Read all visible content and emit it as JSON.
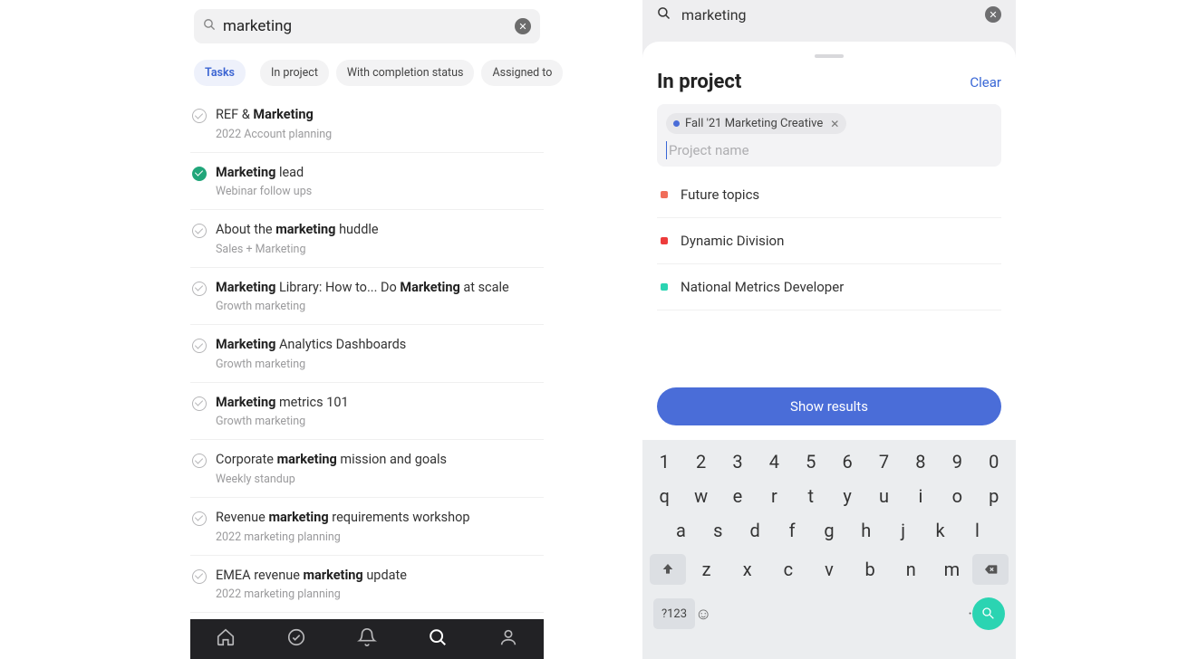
{
  "left": {
    "search_query": "marketing",
    "chips": {
      "tasks": "Tasks",
      "in_project": "In project",
      "with_completion": "With completion status",
      "assigned_to": "Assigned to"
    },
    "results": [
      {
        "title_html": "REF & <b>Marketing</b>",
        "sub": "2022 Account planning",
        "done": false
      },
      {
        "title_html": "<b>Marketing</b> lead",
        "sub": "Webinar follow ups",
        "done": true
      },
      {
        "title_html": "About the <b>marketing</b> huddle",
        "sub": "Sales + Marketing",
        "done": false
      },
      {
        "title_html": "<b>Marketing</b> Library: How to... Do <b>Marketing</b> at scale",
        "sub": "Growth marketing",
        "done": false
      },
      {
        "title_html": "<b>Marketing</b> Analytics Dashboards",
        "sub": "Growth marketing",
        "done": false
      },
      {
        "title_html": "<b>Marketing</b> metrics 101",
        "sub": "Growth marketing",
        "done": false
      },
      {
        "title_html": "Corporate <b>marketing</b> mission and goals",
        "sub": "Weekly standup",
        "done": false
      },
      {
        "title_html": "Revenue <b>marketing</b> requirements workshop",
        "sub": "2022 marketing planning",
        "done": false
      },
      {
        "title_html": "EMEA revenue <b>marketing</b> update",
        "sub": "2022 marketing planning",
        "done": false
      }
    ]
  },
  "right": {
    "search_query": "marketing",
    "sheet_title": "In project",
    "clear_label": "Clear",
    "selected_project": {
      "name": "Fall '21 Marketing Creative",
      "color": "#4a6dd8"
    },
    "input_placeholder": "Project name",
    "projects": [
      {
        "name": "Future topics",
        "color": "#f06d5a"
      },
      {
        "name": "Dynamic Division",
        "color": "#ed3b3b"
      },
      {
        "name": "National Metrics Developer",
        "color": "#2bd4b2"
      }
    ],
    "show_results_label": "Show results",
    "keyboard": {
      "row1": [
        "1",
        "2",
        "3",
        "4",
        "5",
        "6",
        "7",
        "8",
        "9",
        "0"
      ],
      "row2": [
        "q",
        "w",
        "e",
        "r",
        "t",
        "y",
        "u",
        "i",
        "o",
        "p"
      ],
      "row3": [
        "a",
        "s",
        "d",
        "f",
        "g",
        "h",
        "j",
        "k",
        "l"
      ],
      "row4": [
        "z",
        "x",
        "c",
        "v",
        "b",
        "n",
        "m"
      ],
      "sym": "?123"
    }
  }
}
